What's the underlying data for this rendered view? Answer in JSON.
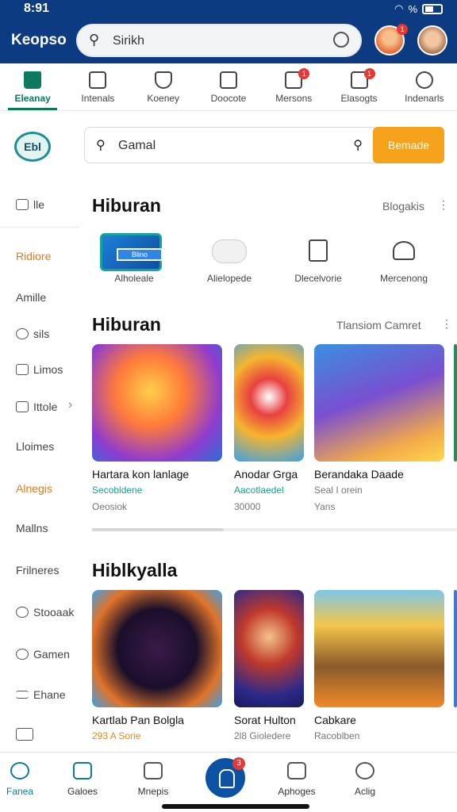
{
  "status_bar": {
    "time": "8:91",
    "network": "%"
  },
  "header": {
    "app_title": "Keopso",
    "search_text": "Sirikh",
    "avatar_badge": "1"
  },
  "tabs": [
    {
      "label": "Eleanay",
      "icon": "home-icon",
      "active": true
    },
    {
      "label": "Intenals",
      "icon": "list-icon"
    },
    {
      "label": "Koeney",
      "icon": "shield-icon"
    },
    {
      "label": "Doocote",
      "icon": "briefcase-icon"
    },
    {
      "label": "Mersons",
      "icon": "inbox-icon",
      "badge": "1"
    },
    {
      "label": "Elasogts",
      "icon": "mail-icon",
      "badge": "1"
    },
    {
      "label": "Indenarls",
      "icon": "person-icon"
    }
  ],
  "sidebar": {
    "logo": "Ebl",
    "items": [
      {
        "label": "lle",
        "icon": "check-box-icon"
      },
      {
        "label": "Ridiore",
        "accent": true
      },
      {
        "label": "Amille"
      },
      {
        "label": "sils",
        "icon": "gear-icon"
      },
      {
        "label": "Limos",
        "icon": "image-icon"
      },
      {
        "label": "Ittole",
        "icon": "panel-icon"
      },
      {
        "label": "Lloimes"
      },
      {
        "label": "Alnegis",
        "accent": true
      },
      {
        "label": "Mallns"
      },
      {
        "label": "Frilneres"
      },
      {
        "label": "Stooaak",
        "icon": "refresh-icon"
      },
      {
        "label": "Gamen",
        "icon": "person-icon"
      },
      {
        "label": "Ehane",
        "icon": "menu-icon"
      },
      {
        "label": "",
        "icon": "camera-icon"
      }
    ]
  },
  "main_search": {
    "text": "Gamal",
    "button": "Bemade"
  },
  "section1": {
    "title": "Hiburan",
    "link": "Blogakis",
    "categories": [
      {
        "label": "Alholeale",
        "badge": "Blino"
      },
      {
        "label": "Alielopede"
      },
      {
        "label": "Dlecelvorie"
      },
      {
        "label": "Mercenong"
      }
    ]
  },
  "section2": {
    "title": "Hiburan",
    "link": "Tlansiom Camret",
    "games": [
      {
        "title": "Hartara kon lanlage",
        "sub": "Secobldene",
        "meta": "Oeosiok"
      },
      {
        "title": "Anodar Grga",
        "sub": "Aacotlaedel",
        "meta": "30000"
      },
      {
        "title": "Berandaka Daade",
        "sub": "Seal I orein",
        "meta": "Yans"
      }
    ]
  },
  "section3": {
    "title": "Hiblkyalla",
    "games": [
      {
        "title": "Kartlab Pan Bolgla",
        "sub": "293 A Sorie"
      },
      {
        "title": "Sorat Hulton",
        "sub": "2l8 Gioledere"
      },
      {
        "title": "Cabkare",
        "sub": "Racoblben"
      }
    ]
  },
  "bottom_nav": [
    {
      "label": "Fanea",
      "active": true
    },
    {
      "label": "Galoes"
    },
    {
      "label": "Mnepis"
    },
    {
      "label": "Aphoges"
    },
    {
      "label": "Aclig"
    }
  ],
  "fab_badge": "3",
  "colors": {
    "header": "#0d3b82",
    "accent_green": "#0d7a5f",
    "search_button": "#f6a21b",
    "badge": "#e53935"
  }
}
